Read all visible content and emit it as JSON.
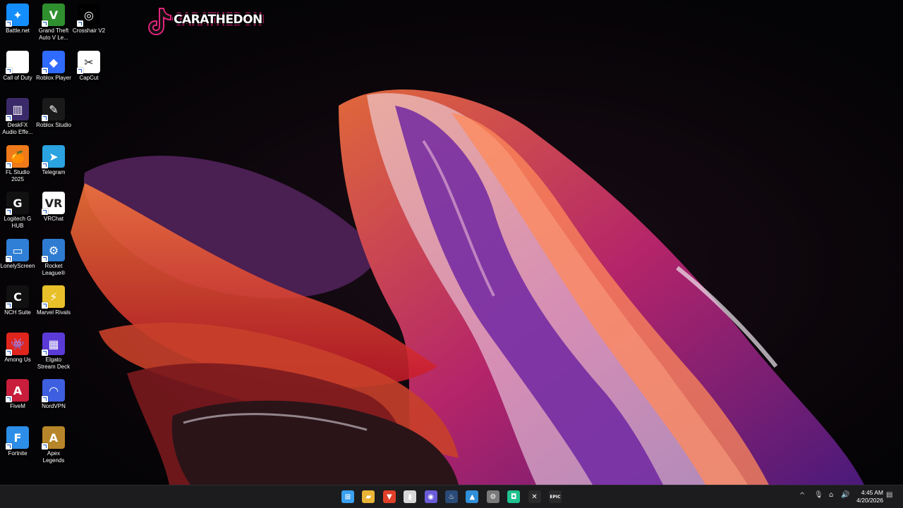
{
  "desktop": {
    "icons": [
      {
        "label": "Battle.net",
        "icon": "battlenet-icon",
        "color": "#148eff"
      },
      {
        "label": "Grand Theft Auto V Le...",
        "icon": "gta-icon",
        "color": "#2f8f2f"
      },
      {
        "label": "Crosshair V2",
        "icon": "crosshair-icon",
        "color": "#000000"
      },
      {
        "label": "Call of Duty",
        "icon": "file-icon",
        "color": "#ffffff"
      },
      {
        "label": "Roblox Player",
        "icon": "roblox-icon",
        "color": "#2f6bff"
      },
      {
        "label": "CapCut",
        "icon": "capcut-icon",
        "color": "#ffffff"
      },
      {
        "label": "DeskFX Audio Effe...",
        "icon": "deskfx-icon",
        "color": "#3a2a6a"
      },
      {
        "label": "Roblox Studio",
        "icon": "roblox-studio-icon",
        "color": "#1a1a1a"
      },
      {
        "label": "FL Studio 2025",
        "icon": "fl-studio-icon",
        "color": "#f07a1a"
      },
      {
        "label": "Telegram",
        "icon": "telegram-icon",
        "color": "#2aa3e0"
      },
      {
        "label": "Logitech G HUB",
        "icon": "logitech-icon",
        "color": "#111111"
      },
      {
        "label": "VRChat",
        "icon": "vrchat-icon",
        "color": "#ffffff"
      },
      {
        "label": "LonelyScreen",
        "icon": "monitor-icon",
        "color": "#2f7fd6"
      },
      {
        "label": "Rocket League®",
        "icon": "rocket-league-icon",
        "color": "#2e7bd2"
      },
      {
        "label": "NCH Suite",
        "icon": "nch-icon",
        "color": "#111111"
      },
      {
        "label": "Marvel Rivals",
        "icon": "marvel-rivals-icon",
        "color": "#e8c12a"
      },
      {
        "label": "Among Us",
        "icon": "among-us-icon",
        "color": "#e0251c"
      },
      {
        "label": "Elgato Stream Deck",
        "icon": "stream-deck-icon",
        "color": "#5b3bd8"
      },
      {
        "label": "FiveM",
        "icon": "fivem-icon",
        "color": "#c81e3c"
      },
      {
        "label": "NordVPN",
        "icon": "nordvpn-icon",
        "color": "#3e5fe0"
      },
      {
        "label": "Fortnite",
        "icon": "fortnite-icon",
        "color": "#2c8ee8"
      },
      {
        "label": "Apex Legends",
        "icon": "apex-icon",
        "color": "#b8862a"
      }
    ],
    "glyphs": [
      "✦",
      "V",
      "◎",
      "",
      "◆",
      "✂",
      "▥",
      "✎",
      "🍊",
      "➤",
      "G",
      "VR",
      "▭",
      "⚙",
      "C",
      "⚡",
      "👾",
      "▦",
      "A",
      "◠",
      "F",
      "A"
    ],
    "logo_text": "CARATHEDON"
  },
  "taskbar": {
    "apps": [
      {
        "icon": "windows-start-icon",
        "color": "#3aa0f0",
        "glyph": "⊞"
      },
      {
        "icon": "file-explorer-icon",
        "color": "#e9b437",
        "glyph": "▰"
      },
      {
        "icon": "brave-icon",
        "color": "#e0402a",
        "glyph": "▼"
      },
      {
        "icon": "app-badge-icon",
        "color": "#d8d8d8",
        "glyph": "▮"
      },
      {
        "icon": "discord-chrome-icon",
        "color": "#6a5cd8",
        "glyph": "◉"
      },
      {
        "icon": "steam-icon",
        "color": "#2a4a78",
        "glyph": "♨"
      },
      {
        "icon": "stream-tool-icon",
        "color": "#2f8fd8",
        "glyph": "▲"
      },
      {
        "icon": "settings-gear-icon",
        "color": "#7a7a7a",
        "glyph": "⚙"
      },
      {
        "icon": "game-app-icon",
        "color": "#1fc18e",
        "glyph": "◘"
      },
      {
        "icon": "xbox-icon",
        "color": "#2a2a2a",
        "glyph": "✕"
      },
      {
        "icon": "epic-games-icon",
        "color": "#2a2a2a",
        "glyph": "EPIC"
      }
    ],
    "tray": {
      "chevron": "^",
      "mic": "🎙",
      "network": "⌂",
      "volume": "🔊",
      "time": "4:45 AM",
      "date": "4/20/2026",
      "notification": "▤"
    }
  }
}
